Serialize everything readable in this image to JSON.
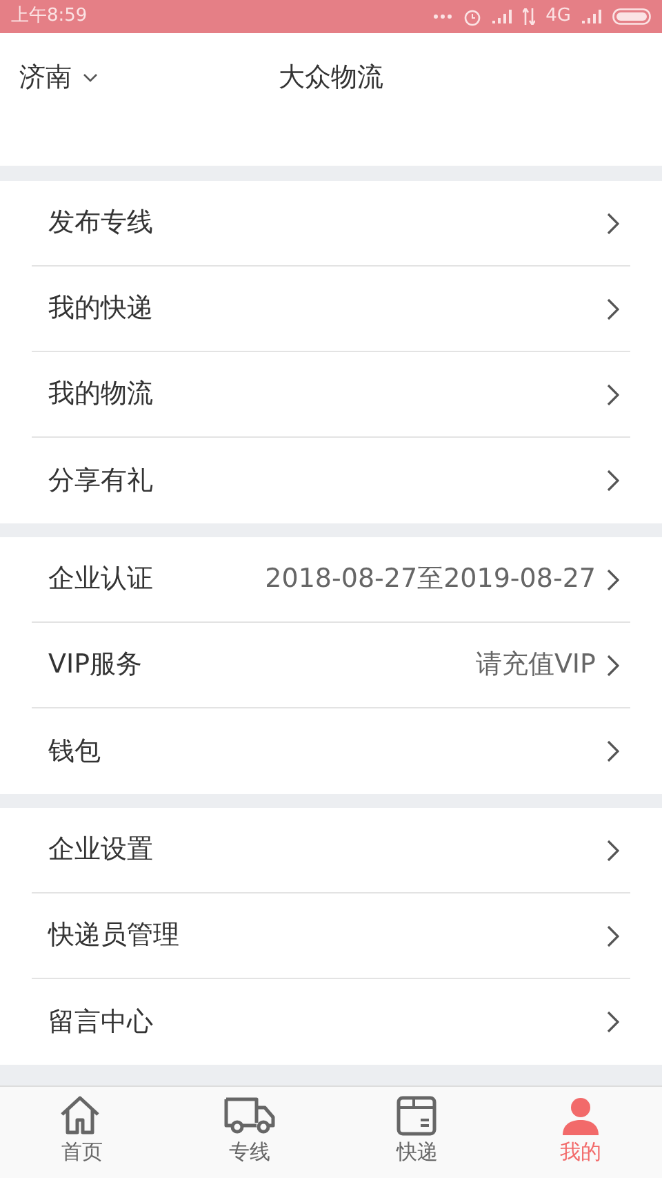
{
  "status_bar": {
    "time": "上午8:59",
    "network": "4G"
  },
  "header": {
    "city": "济南",
    "title": "大众物流"
  },
  "groups": [
    {
      "items": [
        {
          "label": "发布专线"
        },
        {
          "label": "我的快递"
        },
        {
          "label": "我的物流"
        },
        {
          "label": "分享有礼"
        }
      ]
    },
    {
      "items": [
        {
          "label": "企业认证",
          "value": "2018-08-27至2019-08-27"
        },
        {
          "label": "VIP服务",
          "value": "请充值VIP"
        },
        {
          "label": "钱包"
        }
      ]
    },
    {
      "items": [
        {
          "label": "企业设置"
        },
        {
          "label": "快递员管理"
        },
        {
          "label": "留言中心"
        }
      ]
    }
  ],
  "tab_bar": [
    {
      "kind": "home",
      "label": "首页",
      "selected": false
    },
    {
      "kind": "truck",
      "label": "专线",
      "selected": false
    },
    {
      "kind": "parcel",
      "label": "快递",
      "selected": false
    },
    {
      "kind": "person",
      "label": "我的",
      "selected": true
    }
  ]
}
